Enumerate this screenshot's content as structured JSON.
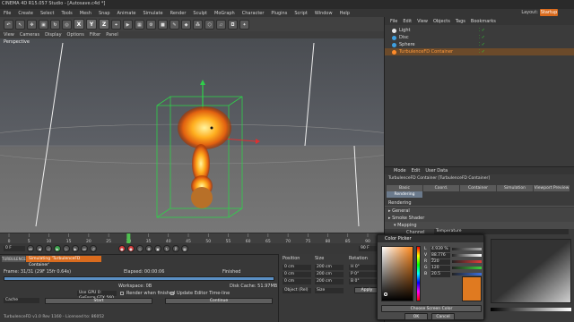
{
  "window": {
    "title": "CINEMA 4D R15.057 Studio - [Autosave.c4d *]"
  },
  "menubar": [
    "File",
    "Create",
    "Select",
    "Tools",
    "Mesh",
    "Snap",
    "Animate",
    "Simulate",
    "Render",
    "Sculpt",
    "MoGraph",
    "Character",
    "Plugins",
    "Script",
    "Window",
    "Help"
  ],
  "layout": {
    "label": "Layout:",
    "value": "Startup"
  },
  "toolbar_axes": [
    "X",
    "Y",
    "Z"
  ],
  "viewport": {
    "menu": [
      "View",
      "Cameras",
      "Display",
      "Options",
      "Filter",
      "Panel"
    ],
    "label": "Perspective"
  },
  "objects": {
    "menu": [
      "File",
      "Edit",
      "View",
      "Objects",
      "Tags",
      "Bookmarks"
    ],
    "items": [
      {
        "name": "Light",
        "color": "#e6e6e6",
        "selected": false
      },
      {
        "name": "Disc",
        "color": "#3fa0e0",
        "selected": false
      },
      {
        "name": "Sphere",
        "color": "#3fa0e0",
        "selected": false
      },
      {
        "name": "TurbulenceFD Container",
        "color": "#ff8c2a",
        "selected": true
      }
    ]
  },
  "attributes": {
    "menu": [
      "Mode",
      "Edit",
      "User Data"
    ],
    "object_title": "TurbulenceFD Container [TurbulenceFD Container]",
    "tabs_row1": [
      "Basic",
      "Coord.",
      "Container",
      "Simulation",
      "Viewport Preview"
    ],
    "tabs_row2": [
      "Rendering"
    ],
    "section": "Rendering",
    "groups": [
      "General",
      "Smoke Shader",
      "Mapping"
    ],
    "channel_label": "Channel",
    "channel_value": "Temperature"
  },
  "timeline": {
    "start": "0 F",
    "end": "90 F",
    "ticks": [
      "0",
      "5",
      "10",
      "15",
      "20",
      "25",
      "30",
      "35",
      "40",
      "45",
      "50",
      "55",
      "60",
      "65",
      "70",
      "75",
      "80",
      "85",
      "90"
    ]
  },
  "simulation": {
    "tab_left": "TURBULENCE",
    "tab_right": "Simulating 'TurbulenceFD Container'",
    "frame": "Frame: 31/31 (29F 15fr 0.64s)",
    "elapsed": "Elapsed: 00:00:06",
    "finished": "Finished",
    "workspace": "Workspace: 0B",
    "disk_cache": "Disk Cache: 51.97MB",
    "gpu": "Use GPU 0: GeForce GTX 560",
    "render_when_finished": "Render when finished",
    "update_editor": "Update Editor Time-line",
    "cache": "Cache",
    "start": "Start",
    "continue": "Continue",
    "footer": "TurbulenceFD v1.0 Rev 1160 - Licensed to: 86052"
  },
  "coordinates": {
    "headers": [
      "Position",
      "Size",
      "Rotation"
    ],
    "rows": [
      [
        "0 cm",
        "200 cm",
        "H 0°"
      ],
      [
        "0 cm",
        "200 cm",
        "P 0°"
      ],
      [
        "0 cm",
        "200 cm",
        "B 0°"
      ]
    ],
    "mode": "Object (Rel)",
    "size_mode": "Size",
    "apply": "Apply"
  },
  "color_picker": {
    "title": "Color Picker",
    "channels": [
      {
        "label": "L",
        "value": "4.939 %",
        "color": "#aaaaaa"
      },
      {
        "label": "V",
        "value": "88.776 %",
        "color": "#ffffff"
      },
      {
        "label": "R",
        "value": "220",
        "color": "#e03b3b"
      },
      {
        "label": "G",
        "value": "120",
        "color": "#3bd03b"
      },
      {
        "label": "B",
        "value": "20.5",
        "color": "#3b6fe0"
      }
    ],
    "choose_screen": "Choose Screen Color",
    "ok": "OK",
    "cancel": "Cancel"
  }
}
